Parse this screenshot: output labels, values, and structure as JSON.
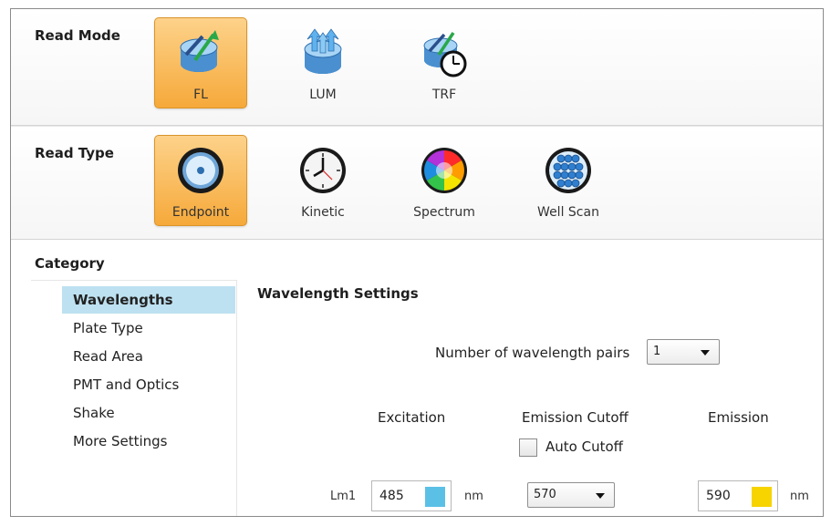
{
  "read_mode": {
    "label": "Read Mode",
    "options": [
      {
        "label": "FL",
        "icon": "fl-plate-icon",
        "selected": true
      },
      {
        "label": "LUM",
        "icon": "lum-plate-icon",
        "selected": false
      },
      {
        "label": "TRF",
        "icon": "trf-plate-clock-icon",
        "selected": false
      }
    ]
  },
  "read_type": {
    "label": "Read Type",
    "options": [
      {
        "label": "Endpoint",
        "icon": "endpoint-well-icon",
        "selected": true
      },
      {
        "label": "Kinetic",
        "icon": "clock-icon",
        "selected": false
      },
      {
        "label": "Spectrum",
        "icon": "color-wheel-icon",
        "selected": false
      },
      {
        "label": "Well Scan",
        "icon": "well-grid-icon",
        "selected": false
      }
    ]
  },
  "category": {
    "title": "Category",
    "items": [
      "Wavelengths",
      "Plate Type",
      "Read Area",
      "PMT and Optics",
      "Shake",
      "More Settings"
    ],
    "active": "Wavelengths"
  },
  "wavelength_settings": {
    "title": "Wavelength Settings",
    "pairs_label": "Number of wavelength pairs",
    "pairs_value": "1",
    "col_excitation": "Excitation",
    "col_emission_cutoff": "Emission Cutoff",
    "col_emission": "Emission",
    "auto_cutoff_label": "Auto Cutoff",
    "auto_cutoff_checked": false,
    "row": {
      "label": "Lm1",
      "excitation": "485",
      "excitation_unit": "nm",
      "excitation_color": "#5bc0e6",
      "cutoff": "570",
      "emission": "590",
      "emission_unit": "nm",
      "emission_color": "#f7d300"
    }
  },
  "colors": {
    "selected_orange": "#f6a93a",
    "active_category": "#bde1f1"
  }
}
